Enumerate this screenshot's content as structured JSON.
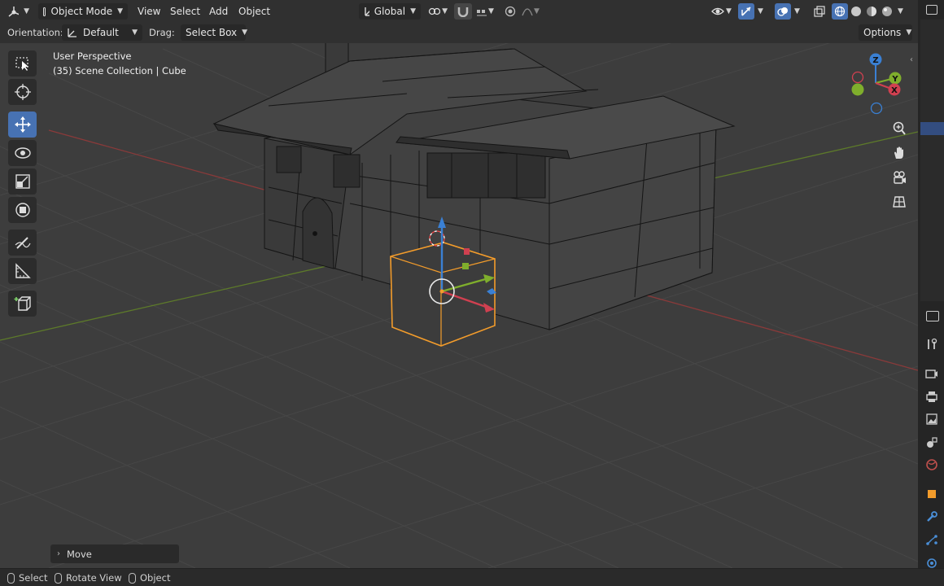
{
  "header": {
    "mode": "Object Mode",
    "menus": [
      "View",
      "Select",
      "Add",
      "Object"
    ],
    "transform_orientation": "Global"
  },
  "tool_header": {
    "orientation_label": "Orientation:",
    "orientation_value": "Default",
    "drag_label": "Drag:",
    "drag_value": "Select Box",
    "options_label": "Options"
  },
  "viewport": {
    "perspective": "User Perspective",
    "collection_info": "(35) Scene Collection | Cube"
  },
  "gizmo_axes": {
    "z": "Z",
    "y": "Y",
    "x": "X"
  },
  "last_operator": {
    "label": "Move"
  },
  "status_bar": {
    "items": [
      {
        "label": "Select"
      },
      {
        "label": "Rotate View"
      },
      {
        "label": "Object"
      }
    ]
  },
  "colors": {
    "selection": "#f39c2b",
    "active_tool": "#4772b3",
    "x_axis": "#c0504d",
    "y_axis": "#7fae2c",
    "z_axis": "#3a80d4"
  }
}
